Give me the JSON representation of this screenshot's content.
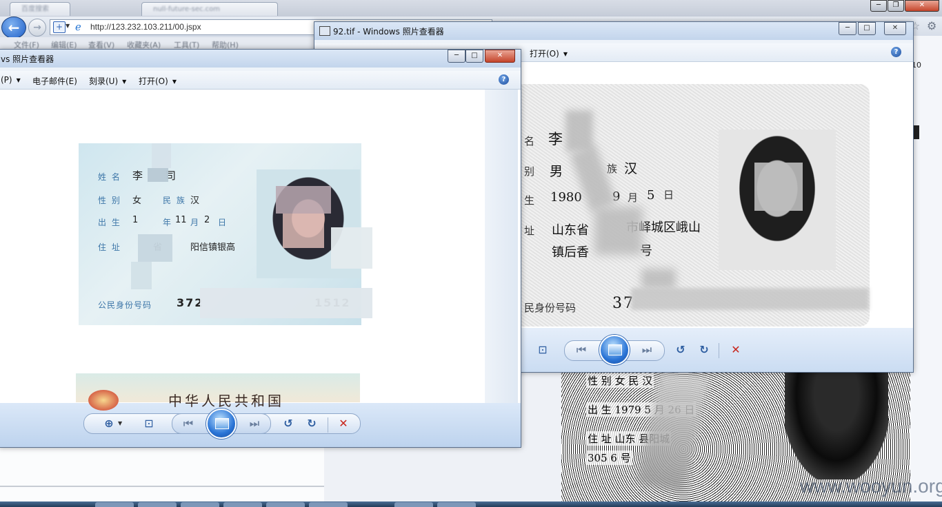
{
  "browser": {
    "tabs": [
      "百度搜索",
      "null-future-sec.com"
    ],
    "address_url": "http://123.232.103.211/00.jspx",
    "menu": [
      "文件(F)",
      "编辑(E)",
      "查看(V)",
      "收藏夹(A)",
      "工具(T)",
      "帮助(H)"
    ],
    "right_edge_text": "10",
    "window_controls": {
      "minimize": "─",
      "restore": "❐",
      "close": "✕"
    }
  },
  "viewer_front": {
    "title": "vs 照片查看器",
    "menu": [
      "(P)",
      "电子邮件(E)",
      "刻录(U)",
      "打开(O)"
    ],
    "help": "?",
    "controls": {
      "minimize": "─",
      "maximize": "□",
      "close": "✕"
    },
    "id_card": {
      "labels": {
        "name": "姓 名",
        "sex": "性 别",
        "ethnicity": "民 族",
        "birth": "出 生",
        "address": "住 址",
        "id_number": "公民身份号码"
      },
      "name": "李",
      "name_tail": "司",
      "sex": "女",
      "ethnicity": "汉",
      "birth_year": "1",
      "birth_year_unit": "年",
      "birth_month": "11",
      "birth_month_unit": "月",
      "birth_day": "2",
      "birth_day_unit": "日",
      "address": "省",
      "address_tail": "阳信镇银高",
      "id_prefix": "372",
      "id_suffix": "1512"
    },
    "card2_title": "中华人民共和国",
    "toolbar": {
      "zoom": "⊕",
      "fit": "⊡",
      "prev": "⏮",
      "next": "⏭",
      "rotate_left": "↺",
      "rotate_right": "↻",
      "delete": "✕"
    }
  },
  "viewer_back": {
    "title": "92.tif - Windows 照片查看器",
    "menu": [
      "打开(O)"
    ],
    "help": "?",
    "controls": {
      "minimize": "─",
      "maximize": "□",
      "close": "✕"
    },
    "id_card": {
      "labels": {
        "name": "名",
        "sex": "别",
        "ethnicity": "族",
        "birth": "生",
        "address": "址",
        "id_number": "民身份号码"
      },
      "name": "李",
      "sex": "男",
      "ethnicity": "汉",
      "birth_year": "1980",
      "birth_month": "9",
      "birth_month_unit": "月",
      "birth_day": "5",
      "birth_day_unit": "日",
      "address_line1_a": "山东省",
      "address_line1_b": "市峄城区峨山",
      "address_line2_a": "镇后香",
      "address_line2_b": "号",
      "id_prefix": "37"
    },
    "toolbar": {
      "fit": "⊡",
      "prev": "⏮",
      "next": "⏭",
      "rotate_left": "↺",
      "rotate_right": "↻",
      "delete": "✕"
    }
  },
  "bottom_scan": {
    "line1": "性 别  女    民    汉",
    "line2": "出 生  1979     5  月 26 日",
    "line3": "住 址  山东      县阳城",
    "line4": "        305        6 号"
  },
  "watermark": "www.wooyun.org"
}
